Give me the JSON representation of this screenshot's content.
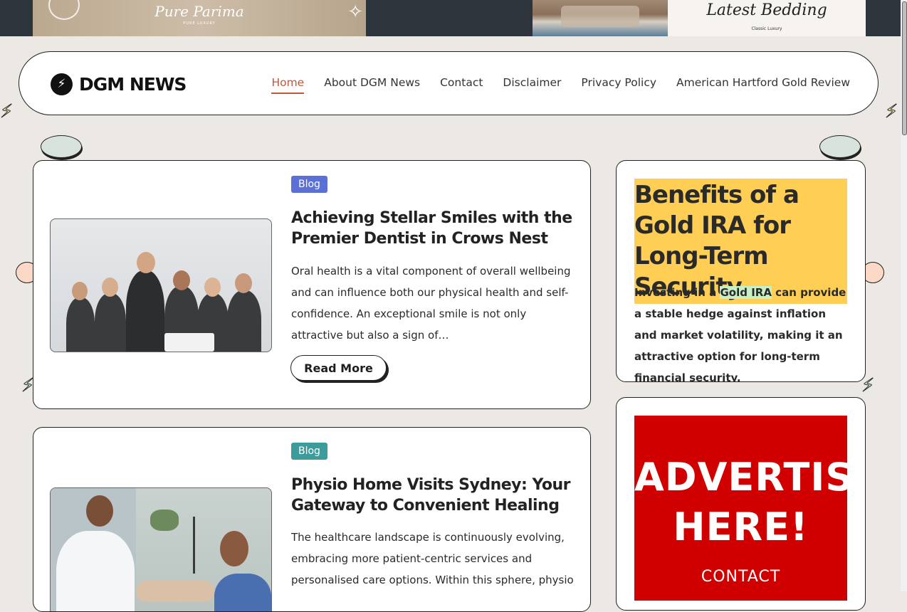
{
  "top_banners": {
    "left": {
      "brand": "Pure Parima",
      "tagline": "PURE LUXURY"
    },
    "right": {
      "brand": "Latest Bedding",
      "tagline": "Classic Luxury"
    }
  },
  "header": {
    "logo_text": "DGM NEWS",
    "nav": [
      "Home",
      "About DGM News",
      "Contact",
      "Disclaimer",
      "Privacy Policy",
      "American Hartford Gold Review"
    ],
    "active_nav": "Home"
  },
  "posts": [
    {
      "category": "Blog",
      "category_color": "#5a70d6",
      "title": "Achieving Stellar Smiles with the Premier Dentist in Crows Nest",
      "excerpt": "Oral health is a vital component of overall wellbeing and can influence both our physical health and self-confidence. An exceptional smile is not only attractive but also a sign of…",
      "read_more": "Read More"
    },
    {
      "category": "Blog",
      "category_color": "#3c9b9b",
      "title": "Physio Home Visits Sydney: Your Gateway to Convenient Healing",
      "excerpt": "The healthcare landscape is continuously evolving, embracing more patient-centric services and personalised care options. Within this sphere, physio"
    }
  ],
  "sidebar": {
    "feature_title": "Benefits of a Gold IRA for Long-Term Security",
    "feature_text_before": "Investing in a ",
    "feature_link": "Gold IRA",
    "feature_text_after": " can provide a stable hedge against inflation and market volatility, making it an attractive option for long-term financial security.",
    "advert_line1": "ADVERTISE",
    "advert_line2": "HERE!",
    "advert_contact": "CONTACT"
  }
}
